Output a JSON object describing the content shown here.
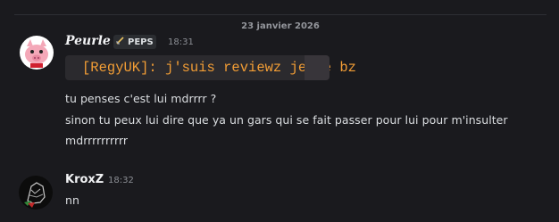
{
  "date_divider": "23 janvier 2026",
  "messages": [
    {
      "author": "Peurle",
      "role_tag": "PEPS",
      "time": "18:31",
      "embed_text": "[RegyUK]: j'suis reviewz je te bz",
      "lines": [
        "tu penses c'est lui mdrrrr ?",
        "sinon tu peux lui dire que ya un gars qui se fait passer pour lui pour m'insulter",
        "mdrrrrrrrrrr"
      ]
    },
    {
      "author": "KroxZ",
      "time": "18:32",
      "lines": [
        "nn"
      ]
    }
  ],
  "colors": {
    "background": "#1a1a1e",
    "embed_text": "#f29d35",
    "tag_background": "#2b2d31"
  },
  "icons": {
    "role_tag_icon": "sword-icon",
    "embed_bullet": "diamond-icon"
  }
}
